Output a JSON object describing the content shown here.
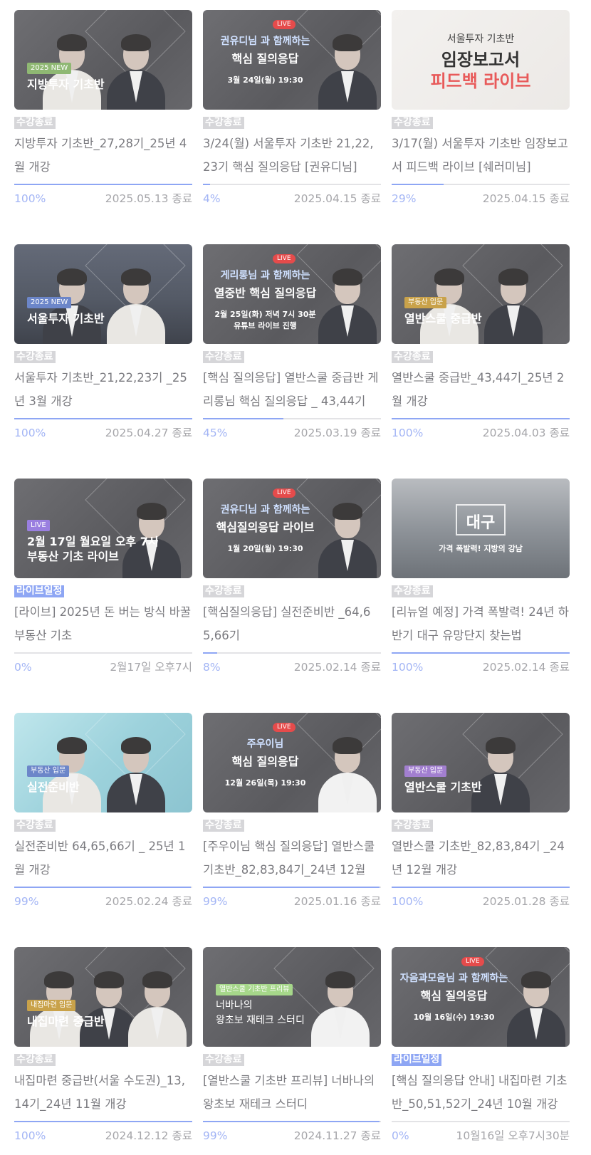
{
  "courses": [
    {
      "thumb": {
        "style": "dark",
        "tag": "2025 NEW",
        "tag_color": "#8fb873",
        "line1": "지방투자 기초반",
        "line2": "",
        "live": "",
        "sub": ""
      },
      "badge": "수강종료",
      "badge_type": "ended",
      "title": "지방투자 기초반_27,28기_25년 4월 개강",
      "progress": "100%",
      "progress_value": 100,
      "date": "2025.05.13 종료"
    },
    {
      "thumb": {
        "style": "dark",
        "tag": "",
        "tag_color": "",
        "line1": "권유디님 과 함께하는",
        "line2": "핵심 질의응답",
        "live": "LIVE",
        "sub": "3월 24일(월) 19:30"
      },
      "badge": "수강종료",
      "badge_type": "ended",
      "title": "3/24(월) 서울투자 기초반 21,22,23기 핵심 질의응답 [권유디님]",
      "progress": "4%",
      "progress_value": 4,
      "date": "2025.04.15 종료"
    },
    {
      "thumb": {
        "style": "paper",
        "tag": "",
        "tag_color": "",
        "line1": "서울투자 기초반",
        "line2": "임장보고서",
        "line3": "피드백 라이브",
        "live": "",
        "sub": ""
      },
      "badge": "수강종료",
      "badge_type": "ended",
      "title": "3/17(월) 서울투자 기초반 임장보고서 피드백 라이브 [쉐러미님]",
      "progress": "29%",
      "progress_value": 29,
      "date": "2025.04.15 종료"
    },
    {
      "thumb": {
        "style": "city",
        "tag": "2025 NEW",
        "tag_color": "#6c86c9",
        "line1": "서울투자 기초반",
        "line2": "",
        "live": "",
        "sub": ""
      },
      "badge": "수강종료",
      "badge_type": "ended",
      "title": "서울투자 기초반_21,22,23기 _25년 3월 개강",
      "progress": "100%",
      "progress_value": 100,
      "date": "2025.04.27 종료"
    },
    {
      "thumb": {
        "style": "dark",
        "tag": "",
        "tag_color": "",
        "line1": "게리롱님 과 함께하는",
        "line2": "열중반 핵심 질의응답",
        "live": "LIVE",
        "sub": "2월 25일(화) 저녁 7시 30분",
        "sub2": "유튜브 라이브 진행"
      },
      "badge": "수강종료",
      "badge_type": "ended",
      "title": "[핵심 질의응답] 열반스쿨 중급반 게리롱님 핵심 질의응답 _ 43,44기",
      "progress": "45%",
      "progress_value": 45,
      "date": "2025.03.19 종료"
    },
    {
      "thumb": {
        "style": "dark",
        "tag": "부동산 입문",
        "tag_color": "#c9a24a",
        "line1": "열반스쿨 중급반",
        "line2": "",
        "live": "",
        "sub": ""
      },
      "badge": "수강종료",
      "badge_type": "ended",
      "title": "열반스쿨 중급반_43,44기_25년 2월 개강",
      "progress": "100%",
      "progress_value": 100,
      "date": "2025.04.03 종료"
    },
    {
      "thumb": {
        "style": "dark",
        "tag": "LIVE",
        "tag_color": "#9a7fe0",
        "line1": "2월 17일 월요일 오후 7시",
        "line2": "부동산 기초 라이브",
        "live": "",
        "sub": ""
      },
      "badge": "라이브일정",
      "badge_type": "live",
      "title": "[라이브] 2025년 돈 버는 방식 바꿀 부동산 기초",
      "progress": "0%",
      "progress_value": 0,
      "date": "2월17일 오후7시"
    },
    {
      "thumb": {
        "style": "dark",
        "tag": "",
        "tag_color": "",
        "line1": "권유디님 과 함께하는",
        "line2": "핵심질의응답 라이브",
        "live": "LIVE",
        "sub": "1월 20일(월) 19:30"
      },
      "badge": "수강종료",
      "badge_type": "ended",
      "title": "[핵심질의응답] 실전준비반 _64,65,66기",
      "progress": "8%",
      "progress_value": 8,
      "date": "2025.02.14 종료"
    },
    {
      "thumb": {
        "style": "bldg",
        "tag": "",
        "tag_color": "",
        "line1": "대구",
        "line2": "가격 폭발력! 지방의 강남",
        "live": "",
        "sub": ""
      },
      "badge": "수강종료",
      "badge_type": "ended",
      "title": "[리뉴얼 예정] 가격 폭발력! 24년 하반기 대구 유망단지 찾는법",
      "progress": "100%",
      "progress_value": 100,
      "date": "2025.02.14 종료"
    },
    {
      "thumb": {
        "style": "aqua",
        "tag": "부동산 입문",
        "tag_color": "#6c86c9",
        "line1": "실전준비반",
        "line2": "",
        "live": "",
        "sub": ""
      },
      "badge": "수강종료",
      "badge_type": "ended",
      "title": "실전준비반 64,65,66기 _ 25년 1월 개강",
      "progress": "99%",
      "progress_value": 99,
      "date": "2025.02.24 종료"
    },
    {
      "thumb": {
        "style": "dark",
        "tag": "",
        "tag_color": "",
        "line1": "주우이님",
        "line2": "핵심 질의응답",
        "live": "LIVE",
        "sub": "12월 26일(목) 19:30"
      },
      "badge": "수강종료",
      "badge_type": "ended",
      "title": "[주우이님 핵심 질의응답] 열반스쿨 기초반_82,83,84기_24년 12월",
      "progress": "99%",
      "progress_value": 99,
      "date": "2025.01.16 종료"
    },
    {
      "thumb": {
        "style": "dark",
        "tag": "부동산 입문",
        "tag_color": "#a27fd0",
        "line1": "열반스쿨 기초반",
        "line2": "",
        "live": "",
        "sub": ""
      },
      "badge": "수강종료",
      "badge_type": "ended",
      "title": "열반스쿨 기초반_82,83,84기 _24년 12월 개강",
      "progress": "100%",
      "progress_value": 100,
      "date": "2025.01.28 종료"
    },
    {
      "thumb": {
        "style": "dark",
        "tag": "내집마련 입문",
        "tag_color": "#c9a24a",
        "line1": "내집마련 중급반",
        "line2": "",
        "live": "",
        "sub": ""
      },
      "badge": "수강종료",
      "badge_type": "ended",
      "title": "내집마련 중급반(서울 수도권)_13,14기_24년 11월 개강",
      "progress": "100%",
      "progress_value": 100,
      "date": "2024.12.12 종료"
    },
    {
      "thumb": {
        "style": "dark",
        "tag": "열반스쿨 기초반 프리뷰",
        "tag_color": "#a6d78a",
        "line1": "너바나의",
        "line2": "왕초보 재테크 스터디",
        "live": "",
        "sub": ""
      },
      "badge": "수강종료",
      "badge_type": "ended",
      "title": "[열반스쿨 기초반 프리뷰] 너바나의 왕초보 재테크 스터디",
      "progress": "99%",
      "progress_value": 99,
      "date": "2024.11.27 종료"
    },
    {
      "thumb": {
        "style": "dark",
        "tag": "",
        "tag_color": "",
        "line1": "자음과모음님 과 함께하는",
        "line2": "핵심 질의응답",
        "live": "LIVE",
        "sub": "10월 16일(수) 19:30"
      },
      "badge": "라이브일정",
      "badge_type": "live",
      "title": "[핵심 질의응답 안내] 내집마련 기초반_50,51,52기_24년 10월 개강",
      "progress": "0%",
      "progress_value": 0,
      "date": "10월16일 오후7시30분"
    }
  ]
}
